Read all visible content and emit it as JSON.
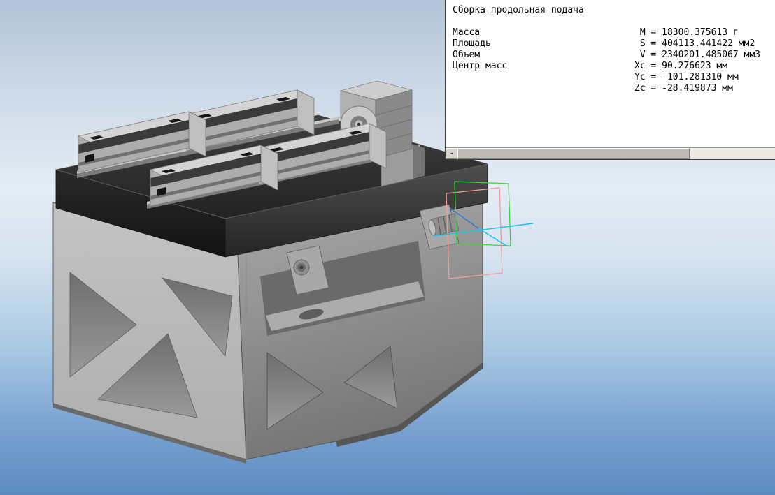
{
  "panel": {
    "title": "Сборка продольная подача",
    "rows": [
      {
        "label": "Масса",
        "value": " M = 18300.375613 г"
      },
      {
        "label": "Площадь",
        "value": " S = 404113.441422 мм2"
      },
      {
        "label": "Объем",
        "value": " V = 2340201.485067 мм3"
      },
      {
        "label": "Центр масс",
        "value": "Xc = 90.276623 мм"
      },
      {
        "label": "",
        "value": "Yc = -101.281310 мм"
      },
      {
        "label": "",
        "value": "Zc = -28.419873 мм"
      }
    ],
    "scrollbar": {
      "left_arrow_glyph": "◄"
    }
  },
  "viewport": {
    "colors": {
      "background_top": "#b2c3d8",
      "background_bottom": "#5c8ac0",
      "base_gray": "#b5b5b5",
      "plate_dark": "#2b2b2b",
      "datum_plane_green": "#3fd23f",
      "datum_plane_pink": "#f39c9c",
      "axis_cyan": "#19c3ef",
      "axis_blue": "#3a78c9"
    }
  }
}
